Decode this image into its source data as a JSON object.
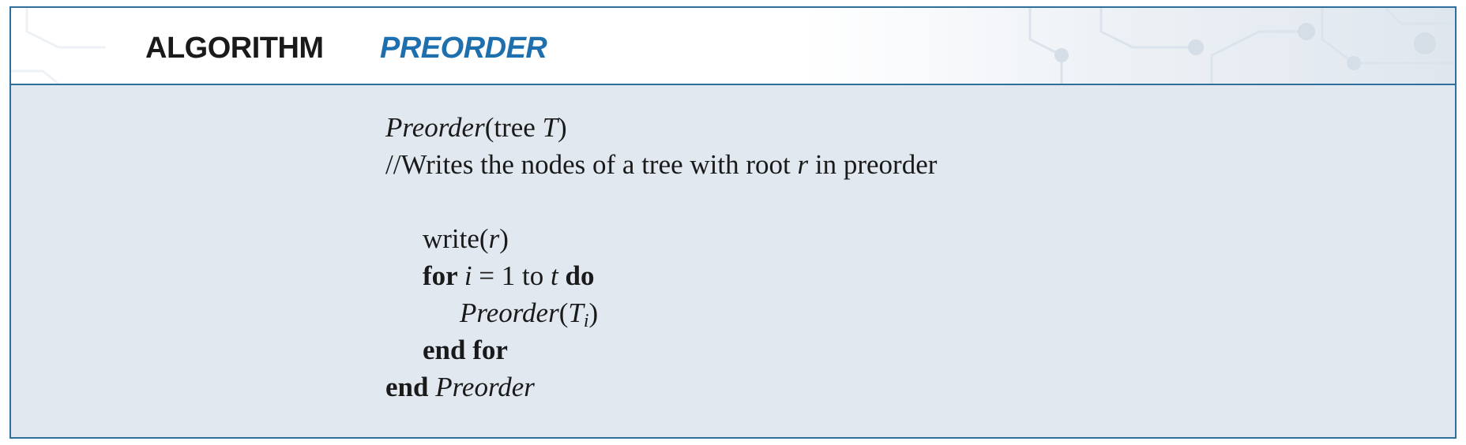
{
  "header": {
    "keyword": "ALGORITHM",
    "name": "PREORDER"
  },
  "code": {
    "signature": {
      "name": "Preorder",
      "params": "(tree ",
      "param_var": "T",
      "close": ")"
    },
    "comment": {
      "before": "//Writes the nodes of a tree with root ",
      "var": "r",
      "after": " in preorder"
    },
    "write": {
      "fn": "write(",
      "var": "r",
      "close": ")"
    },
    "for_loop": {
      "kw_for": "for ",
      "var_i": "i",
      "mid": " = 1 to ",
      "var_t": "t",
      "kw_do": " do"
    },
    "recursive_call": {
      "name": "Preorder",
      "open": "(",
      "var": "T",
      "sub": "i",
      "close": ")"
    },
    "end_for": "end for",
    "end_proc": {
      "kw": "end ",
      "name": "Preorder"
    }
  },
  "colors": {
    "border": "#2e6f9b",
    "panel_bg": "#e1e8f0",
    "algorithm_name": "#1d6fad",
    "text": "#1a1a1a"
  }
}
